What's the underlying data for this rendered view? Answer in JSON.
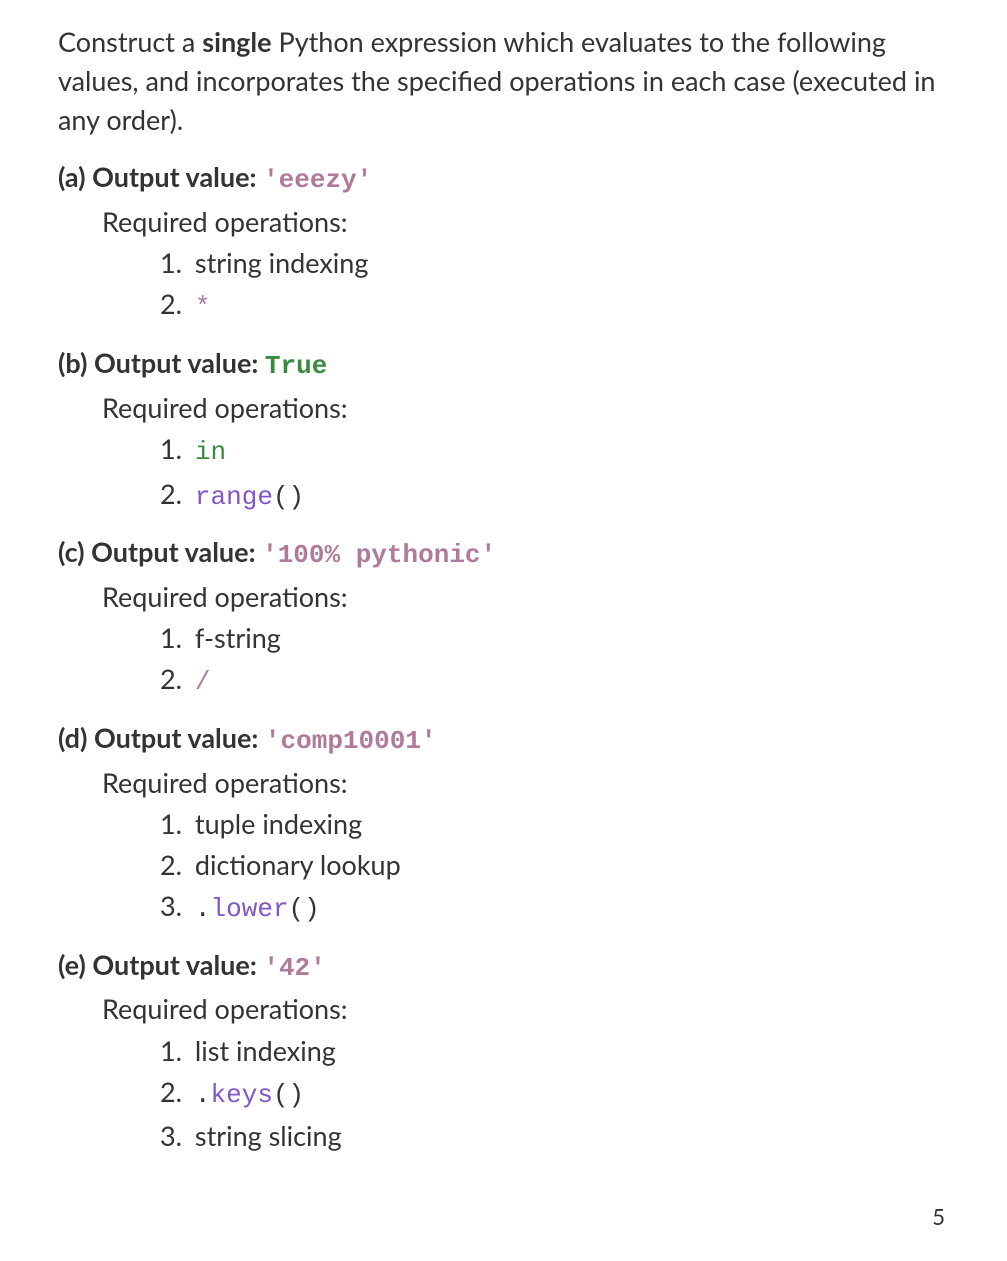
{
  "intro": {
    "pre": "Construct a ",
    "bold": "single",
    "post": " Python expression which evaluates to the following values, and incorporates the specified operations in each case (executed in any order)."
  },
  "requiredOpsLabel": "Required operations:",
  "outputValueLabel": "Output value:",
  "parts": {
    "a": {
      "label": "(a)",
      "code_segments": [
        {
          "t": "'eeezy'",
          "cls": ""
        }
      ],
      "ops": [
        [
          {
            "t": "string indexing",
            "cls": "plain"
          }
        ],
        [
          {
            "t": "*",
            "cls": "code"
          }
        ]
      ]
    },
    "b": {
      "label": "(b)",
      "code_segments": [
        {
          "t": "True",
          "cls": "kw"
        }
      ],
      "ops": [
        [
          {
            "t": "in",
            "cls": "kw"
          }
        ],
        [
          {
            "t": "range",
            "cls": "fn"
          },
          {
            "t": "()",
            "cls": "punct"
          }
        ]
      ]
    },
    "c": {
      "label": "(c)",
      "code_segments": [
        {
          "t": "'100% pythonic'",
          "cls": ""
        }
      ],
      "ops": [
        [
          {
            "t": "f-string",
            "cls": "plain"
          }
        ],
        [
          {
            "t": "/",
            "cls": "code"
          }
        ]
      ]
    },
    "d": {
      "label": "(d)",
      "code_segments": [
        {
          "t": "'comp10001'",
          "cls": ""
        }
      ],
      "ops": [
        [
          {
            "t": "tuple indexing",
            "cls": "plain"
          }
        ],
        [
          {
            "t": "dictionary lookup",
            "cls": "plain"
          }
        ],
        [
          {
            "t": ".",
            "cls": "punct"
          },
          {
            "t": "lower",
            "cls": "fn"
          },
          {
            "t": "()",
            "cls": "punct"
          }
        ]
      ]
    },
    "e": {
      "label": "(e)",
      "code_segments": [
        {
          "t": "'42'",
          "cls": ""
        }
      ],
      "ops": [
        [
          {
            "t": "list indexing",
            "cls": "plain"
          }
        ],
        [
          {
            "t": ".",
            "cls": "punct"
          },
          {
            "t": "keys",
            "cls": "fn"
          },
          {
            "t": "()",
            "cls": "punct"
          }
        ],
        [
          {
            "t": "string slicing",
            "cls": "plain"
          }
        ]
      ]
    }
  },
  "pageNumber": "5"
}
